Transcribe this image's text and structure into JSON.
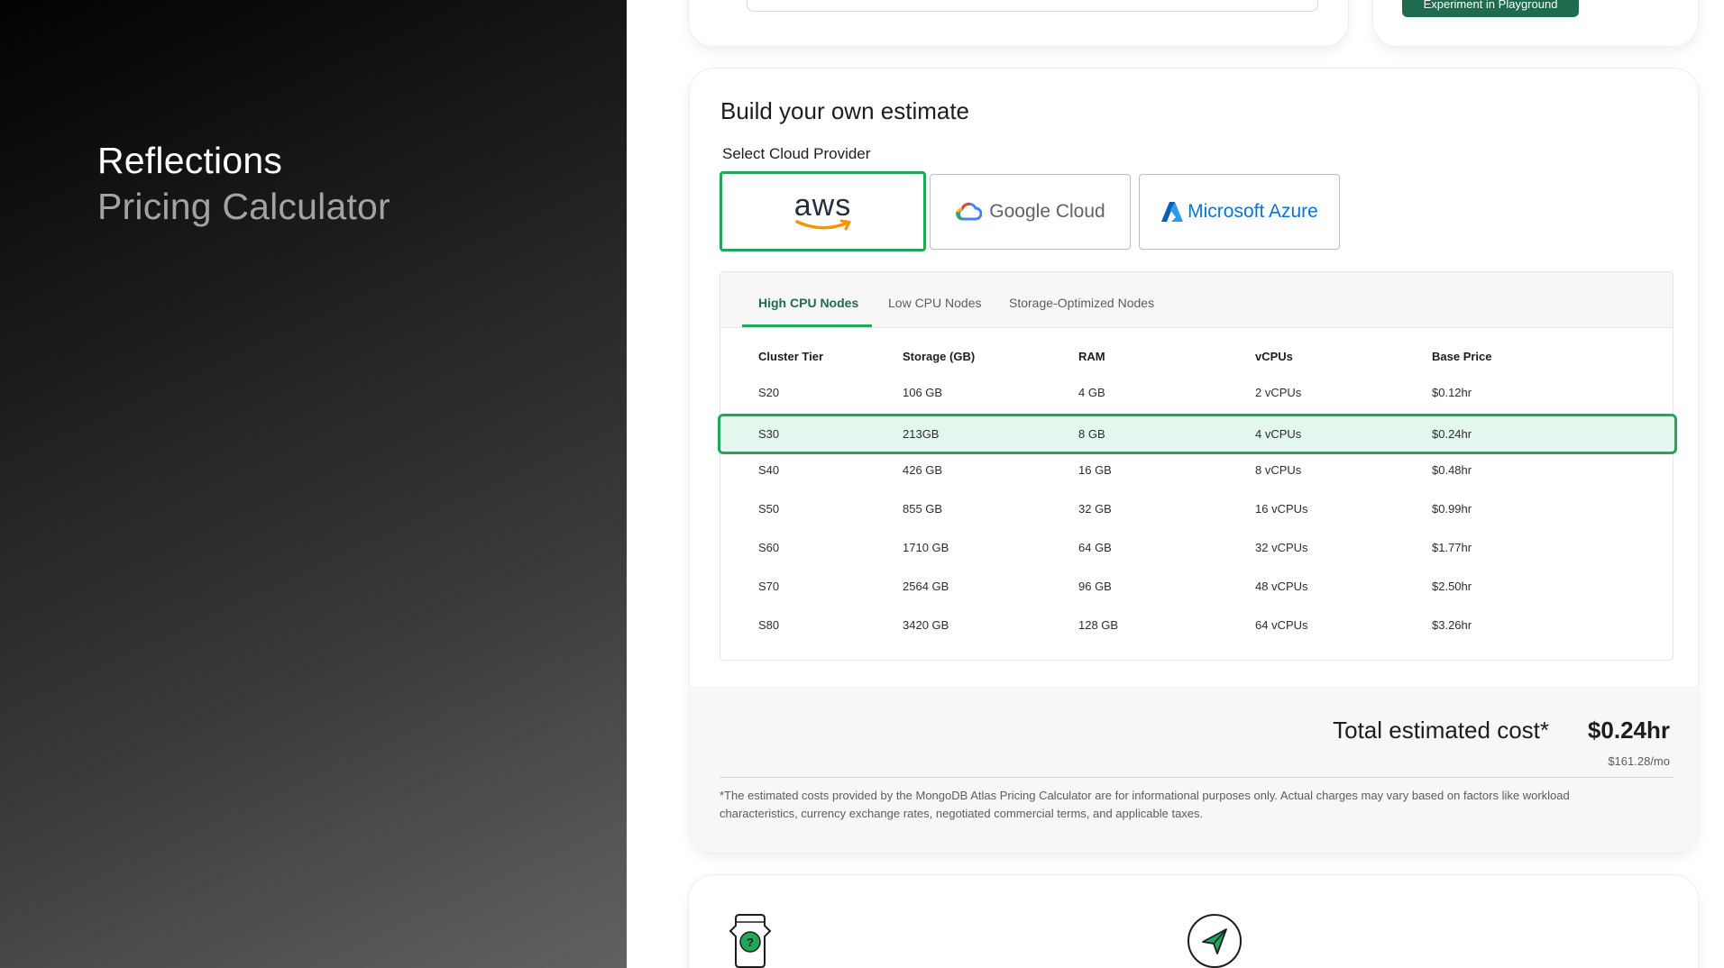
{
  "hero": {
    "title": "Reflections",
    "subtitle": "Pricing Calculator"
  },
  "top_cards": {
    "playground_button": "Experiment in Playground"
  },
  "estimate": {
    "title": "Build your own estimate",
    "provider_label": "Select Cloud Provider",
    "providers": [
      {
        "name": "aws",
        "selected": true
      },
      {
        "name": "Google Cloud",
        "selected": false
      },
      {
        "name": "Microsoft Azure",
        "selected": false
      }
    ],
    "tabs": [
      "High CPU Nodes",
      "Low CPU Nodes",
      "Storage-Optimized Nodes"
    ],
    "active_tab": "High CPU Nodes",
    "columns": [
      "Cluster Tier",
      "Storage (GB)",
      "RAM",
      "vCPUs",
      "Base Price"
    ],
    "rows": [
      [
        "S20",
        "106 GB",
        "4 GB",
        "2 vCPUs",
        "$0.12hr"
      ],
      [
        "S30",
        "213GB",
        "8 GB",
        "4 vCPUs",
        "$0.24hr"
      ],
      [
        "S40",
        "426 GB",
        "16 GB",
        "8 vCPUs",
        "$0.48hr"
      ],
      [
        "S50",
        "855 GB",
        "32 GB",
        "16 vCPUs",
        "$0.99hr"
      ],
      [
        "S60",
        "1710 GB",
        "64 GB",
        "32 vCPUs",
        "$1.77hr"
      ],
      [
        "S70",
        "2564 GB",
        "96 GB",
        "48 vCPUs",
        "$2.50hr"
      ],
      [
        "S80",
        "3420 GB",
        "128 GB",
        "64 vCPUs",
        "$3.26hr"
      ]
    ],
    "selected_row": "S30",
    "total_label": "Total estimated cost*",
    "total_value": "$0.24hr",
    "total_monthly": "$161.28/mo",
    "disclaimer": "*The estimated costs provided by the MongoDB Atlas Pricing Calculator are for informational purposes only. Actual charges may vary based on factors like workload characteristics, currency exchange rates, negotiated commercial terms, and applicable taxes."
  },
  "bottom_icons": [
    "help-icon",
    "send-icon"
  ],
  "colors": {
    "accent": "#23a55a",
    "accent_dark": "#1f6b4d",
    "selected_row_bg": "#e3f7ef"
  }
}
